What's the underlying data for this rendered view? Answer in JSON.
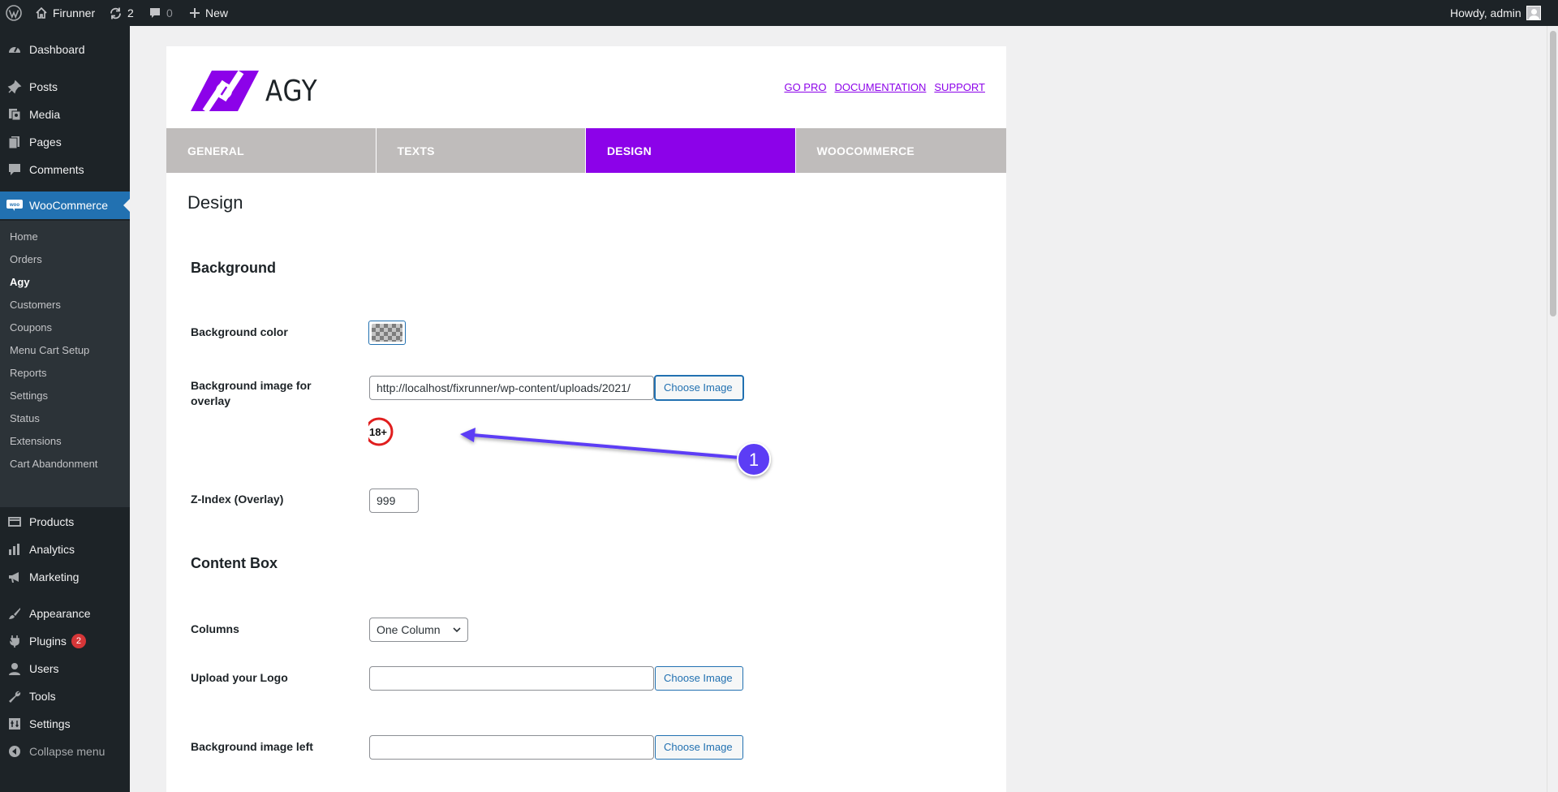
{
  "admin_bar": {
    "site_name": "Firunner",
    "updates_count": "2",
    "comments_count": "0",
    "new_label": "New",
    "greeting": "Howdy, admin",
    "icons": [
      "wordpress-logo-icon",
      "home-icon",
      "updates-icon",
      "comment-icon",
      "plus-icon"
    ]
  },
  "sidebar": {
    "top_items": [
      {
        "label": "Dashboard",
        "icon": "dashboard-icon"
      },
      {
        "label": "Posts",
        "icon": "pin-icon"
      },
      {
        "label": "Media",
        "icon": "media-icon"
      },
      {
        "label": "Pages",
        "icon": "pages-icon"
      },
      {
        "label": "Comments",
        "icon": "comment-icon"
      },
      {
        "label": "WooCommerce",
        "icon": "woocommerce-icon"
      }
    ],
    "woocommerce_submenu": [
      "Home",
      "Orders",
      "Agy",
      "Customers",
      "Coupons",
      "Menu Cart Setup",
      "Reports",
      "Settings",
      "Status",
      "Extensions",
      "Cart Abandonment"
    ],
    "current_submenu": "Agy",
    "bottom_items": [
      {
        "label": "Products",
        "icon": "products-icon"
      },
      {
        "label": "Analytics",
        "icon": "analytics-icon"
      },
      {
        "label": "Marketing",
        "icon": "megaphone-icon"
      },
      {
        "label": "Appearance",
        "icon": "brush-icon"
      },
      {
        "label": "Plugins",
        "icon": "plugin-icon",
        "badge": "2"
      },
      {
        "label": "Users",
        "icon": "users-icon"
      },
      {
        "label": "Tools",
        "icon": "wrench-icon"
      },
      {
        "label": "Settings",
        "icon": "settings-icon"
      }
    ],
    "collapse_label": "Collapse menu"
  },
  "header": {
    "brand": "AGY",
    "links": [
      "GO PRO",
      "DOCUMENTATION",
      "SUPPORT"
    ],
    "accent_color": "#8c02e9"
  },
  "tabs": [
    {
      "label": "GENERAL",
      "active": false
    },
    {
      "label": "TEXTS",
      "active": false
    },
    {
      "label": "DESIGN",
      "active": true
    },
    {
      "label": "WOOCOMMERCE",
      "active": false
    }
  ],
  "main": {
    "page_title": "Design",
    "background": {
      "heading": "Background",
      "bg_color_label": "Background color",
      "bg_image_label": "Background image for overlay",
      "bg_image_value": "http://localhost/fixrunner/wp-content/uploads/2021/",
      "choose_image": "Choose Image",
      "preview_text": "18+",
      "zindex_label": "Z-Index (Overlay)",
      "zindex_value": "999"
    },
    "content_box": {
      "heading": "Content Box",
      "columns_label": "Columns",
      "columns_value": "One Column",
      "logo_label": "Upload your Logo",
      "logo_value": "",
      "choose_image": "Choose Image",
      "bg_left_label": "Background image left",
      "bg_left_value": "",
      "choose_image_2": "Choose Image"
    }
  },
  "annotation": {
    "marker": "1",
    "color": "#5b3cf5"
  }
}
